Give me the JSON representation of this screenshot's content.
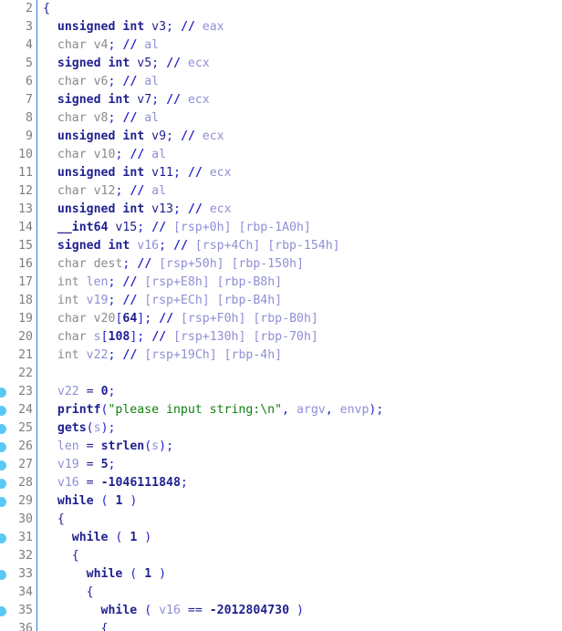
{
  "view": {
    "name": "decompiler-pseudocode",
    "background": "#ffffff",
    "gutter_rule_color": "#2f7fd8",
    "breakpoint_color": "#5ac8f5",
    "line_number_color": "#7e7e7e",
    "first_line": 2,
    "last_line": 36,
    "line_height_px": 20
  },
  "colors": {
    "keyword": "#1f1f8f",
    "dim_type": "#8a8a8a",
    "punctuation": "#2222cc",
    "comment_marker": "#2222cc",
    "register_comment": "#8f8fd6",
    "function": "#1f1f8f",
    "string": "#108010",
    "local_variable": "#8f8fd6",
    "number": "#1f1f8f"
  },
  "lines": [
    {
      "n": "2",
      "bp": false,
      "indent": 0,
      "text": "{"
    },
    {
      "n": "3",
      "bp": false,
      "indent": 0,
      "text": "  unsigned int v3; // eax"
    },
    {
      "n": "4",
      "bp": false,
      "indent": 0,
      "text": "  char v4; // al"
    },
    {
      "n": "5",
      "bp": false,
      "indent": 0,
      "text": "  signed int v5; // ecx"
    },
    {
      "n": "6",
      "bp": false,
      "indent": 0,
      "text": "  char v6; // al"
    },
    {
      "n": "7",
      "bp": false,
      "indent": 0,
      "text": "  signed int v7; // ecx"
    },
    {
      "n": "8",
      "bp": false,
      "indent": 0,
      "text": "  char v8; // al"
    },
    {
      "n": "9",
      "bp": false,
      "indent": 0,
      "text": "  unsigned int v9; // ecx"
    },
    {
      "n": "10",
      "bp": false,
      "indent": 0,
      "text": "  char v10; // al"
    },
    {
      "n": "11",
      "bp": false,
      "indent": 0,
      "text": "  unsigned int v11; // ecx"
    },
    {
      "n": "12",
      "bp": false,
      "indent": 0,
      "text": "  char v12; // al"
    },
    {
      "n": "13",
      "bp": false,
      "indent": 0,
      "text": "  unsigned int v13; // ecx"
    },
    {
      "n": "14",
      "bp": false,
      "indent": 0,
      "text": "  __int64 v15; // [rsp+0h] [rbp-1A0h]"
    },
    {
      "n": "15",
      "bp": false,
      "indent": 0,
      "text": "  signed int v16; // [rsp+4Ch] [rbp-154h]"
    },
    {
      "n": "16",
      "bp": false,
      "indent": 0,
      "text": "  char dest; // [rsp+50h] [rbp-150h]"
    },
    {
      "n": "17",
      "bp": false,
      "indent": 0,
      "text": "  int len; // [rsp+E8h] [rbp-B8h]"
    },
    {
      "n": "18",
      "bp": false,
      "indent": 0,
      "text": "  int v19; // [rsp+ECh] [rbp-B4h]"
    },
    {
      "n": "19",
      "bp": false,
      "indent": 0,
      "text": "  char v20[64]; // [rsp+F0h] [rbp-B0h]"
    },
    {
      "n": "20",
      "bp": false,
      "indent": 0,
      "text": "  char s[108]; // [rsp+130h] [rbp-70h]"
    },
    {
      "n": "21",
      "bp": false,
      "indent": 0,
      "text": "  int v22; // [rsp+19Ch] [rbp-4h]"
    },
    {
      "n": "22",
      "bp": false,
      "indent": 0,
      "text": ""
    },
    {
      "n": "23",
      "bp": true,
      "indent": 0,
      "text": "  v22 = 0;"
    },
    {
      "n": "24",
      "bp": true,
      "indent": 0,
      "text": "  printf(\"please input string:\\n\", argv, envp);"
    },
    {
      "n": "25",
      "bp": true,
      "indent": 0,
      "text": "  gets(s);"
    },
    {
      "n": "26",
      "bp": true,
      "indent": 0,
      "text": "  len = strlen(s);"
    },
    {
      "n": "27",
      "bp": true,
      "indent": 0,
      "text": "  v19 = 5;"
    },
    {
      "n": "28",
      "bp": true,
      "indent": 0,
      "text": "  v16 = -1046111848;"
    },
    {
      "n": "29",
      "bp": true,
      "indent": 0,
      "text": "  while ( 1 )"
    },
    {
      "n": "30",
      "bp": false,
      "indent": 0,
      "text": "  {"
    },
    {
      "n": "31",
      "bp": true,
      "indent": 0,
      "text": "    while ( 1 )"
    },
    {
      "n": "32",
      "bp": false,
      "indent": 0,
      "text": "    {"
    },
    {
      "n": "33",
      "bp": true,
      "indent": 0,
      "text": "      while ( 1 )"
    },
    {
      "n": "34",
      "bp": false,
      "indent": 0,
      "text": "      {"
    },
    {
      "n": "35",
      "bp": true,
      "indent": 0,
      "text": "        while ( v16 == -2012804730 )"
    },
    {
      "n": "36",
      "bp": false,
      "indent": 0,
      "text": "        {"
    }
  ],
  "tokens": {
    "keywords": [
      "unsigned",
      "signed",
      "int",
      "__int64",
      "while",
      "char"
    ],
    "functions": [
      "printf",
      "gets",
      "strlen"
    ],
    "locals": [
      "v22",
      "len",
      "s",
      "argv",
      "envp",
      "v16",
      "v19"
    ],
    "string_literal": "\"please input string:\\n\"",
    "numbers": [
      "0",
      "5",
      "-1046111848",
      "1",
      "-2012804730",
      "64",
      "108"
    ],
    "registers": [
      "eax",
      "al",
      "ecx"
    ],
    "stack_offsets": [
      "[rsp+0h] [rbp-1A0h]",
      "[rsp+4Ch] [rbp-154h]",
      "[rsp+50h] [rbp-150h]",
      "[rsp+E8h] [rbp-B8h]",
      "[rsp+ECh] [rbp-B4h]",
      "[rsp+F0h] [rbp-B0h]",
      "[rsp+130h] [rbp-70h]",
      "[rsp+19Ch] [rbp-4h]"
    ]
  }
}
